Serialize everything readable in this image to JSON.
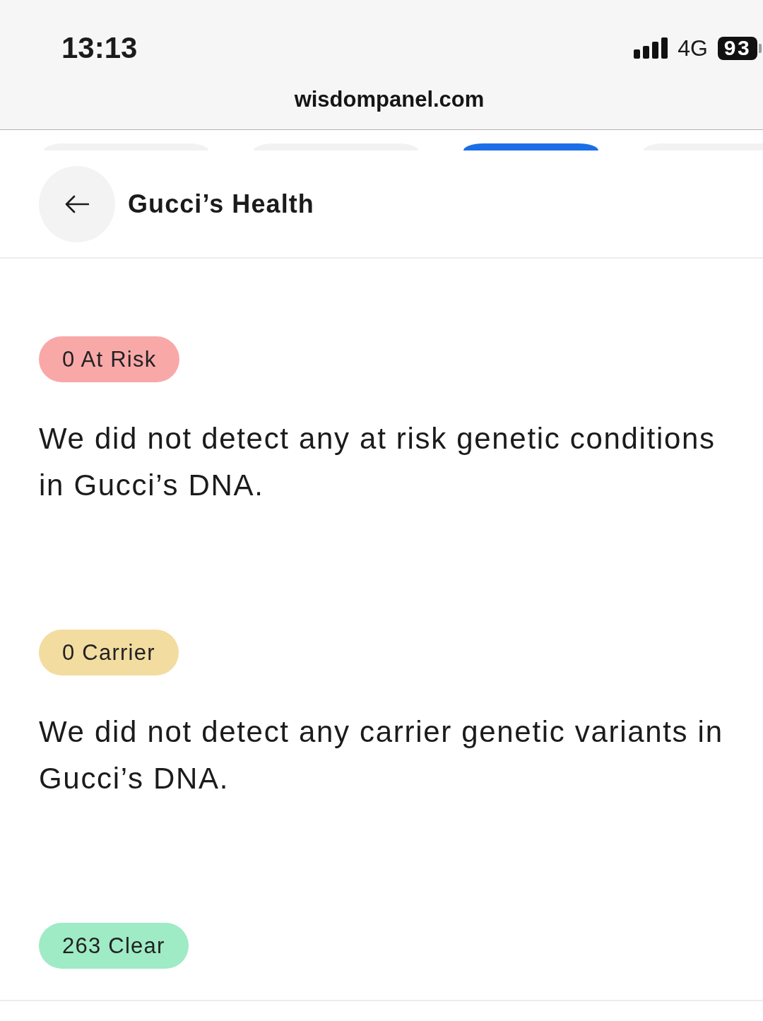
{
  "status_bar": {
    "time": "13:13",
    "network": "4G",
    "battery": "93"
  },
  "address_bar": {
    "url": "wisdompanel.com"
  },
  "tabs": [
    {
      "selected": false
    },
    {
      "selected": false
    },
    {
      "selected": true
    },
    {
      "selected": false
    }
  ],
  "header": {
    "title": "Gucci’s Health"
  },
  "sections": [
    {
      "badge": "0 At Risk",
      "color": "#f9a8a8",
      "text": "We did not detect any at risk genetic conditions in Gucci’s DNA."
    },
    {
      "badge": "0 Carrier",
      "color": "#f2dca0",
      "text": "We did not detect any carrier genetic variants in Gucci’s DNA."
    },
    {
      "badge": "263 Clear",
      "color": "#9eebc6"
    }
  ]
}
